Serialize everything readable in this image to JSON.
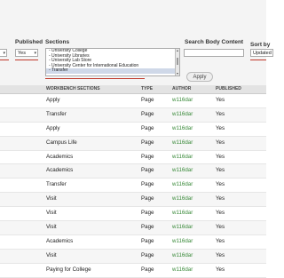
{
  "filters": {
    "published": {
      "label": "Published",
      "value": "Yes"
    },
    "sections": {
      "label": "Sections",
      "options": [
        "- University College",
        "- University Libraries",
        "- University Lab Store",
        "- University Center for International Education",
        "- Transfer"
      ],
      "selected_index": 4
    },
    "search_body": {
      "label": "Search Body Content",
      "value": ""
    },
    "sort_by": {
      "label": "Sort by",
      "value": "Updated"
    },
    "apply_label": "Apply"
  },
  "table": {
    "headers": [
      "WORKBENCH SECTIONS",
      "TYPE",
      "AUTHOR",
      "PUBLISHED"
    ],
    "rows": [
      {
        "section": "Apply",
        "type": "Page",
        "author": "w116dar",
        "published": "Yes"
      },
      {
        "section": "Transfer",
        "type": "Page",
        "author": "w116dar",
        "published": "Yes"
      },
      {
        "section": "Apply",
        "type": "Page",
        "author": "w116dar",
        "published": "Yes"
      },
      {
        "section": "Campus Life",
        "type": "Page",
        "author": "w116dar",
        "published": "Yes"
      },
      {
        "section": "Academics",
        "type": "Page",
        "author": "w116dar",
        "published": "Yes"
      },
      {
        "section": "Academics",
        "type": "Page",
        "author": "w116dar",
        "published": "Yes"
      },
      {
        "section": "Transfer",
        "type": "Page",
        "author": "w116dar",
        "published": "Yes"
      },
      {
        "section": "Visit",
        "type": "Page",
        "author": "w116dar",
        "published": "Yes"
      },
      {
        "section": "Visit",
        "type": "Page",
        "author": "w116dar",
        "published": "Yes"
      },
      {
        "section": "Visit",
        "type": "Page",
        "author": "w116dar",
        "published": "Yes"
      },
      {
        "section": "Academics",
        "type": "Page",
        "author": "w116dar",
        "published": "Yes"
      },
      {
        "section": "Visit",
        "type": "Page",
        "author": "w116dar",
        "published": "Yes"
      },
      {
        "section": "Paying for College",
        "type": "Page",
        "author": "w116dar",
        "published": "Yes"
      }
    ]
  },
  "colors": {
    "accent_underline": "#c0392b",
    "author_link": "#3a8a3a",
    "header_bg": "#e3e3e3"
  }
}
